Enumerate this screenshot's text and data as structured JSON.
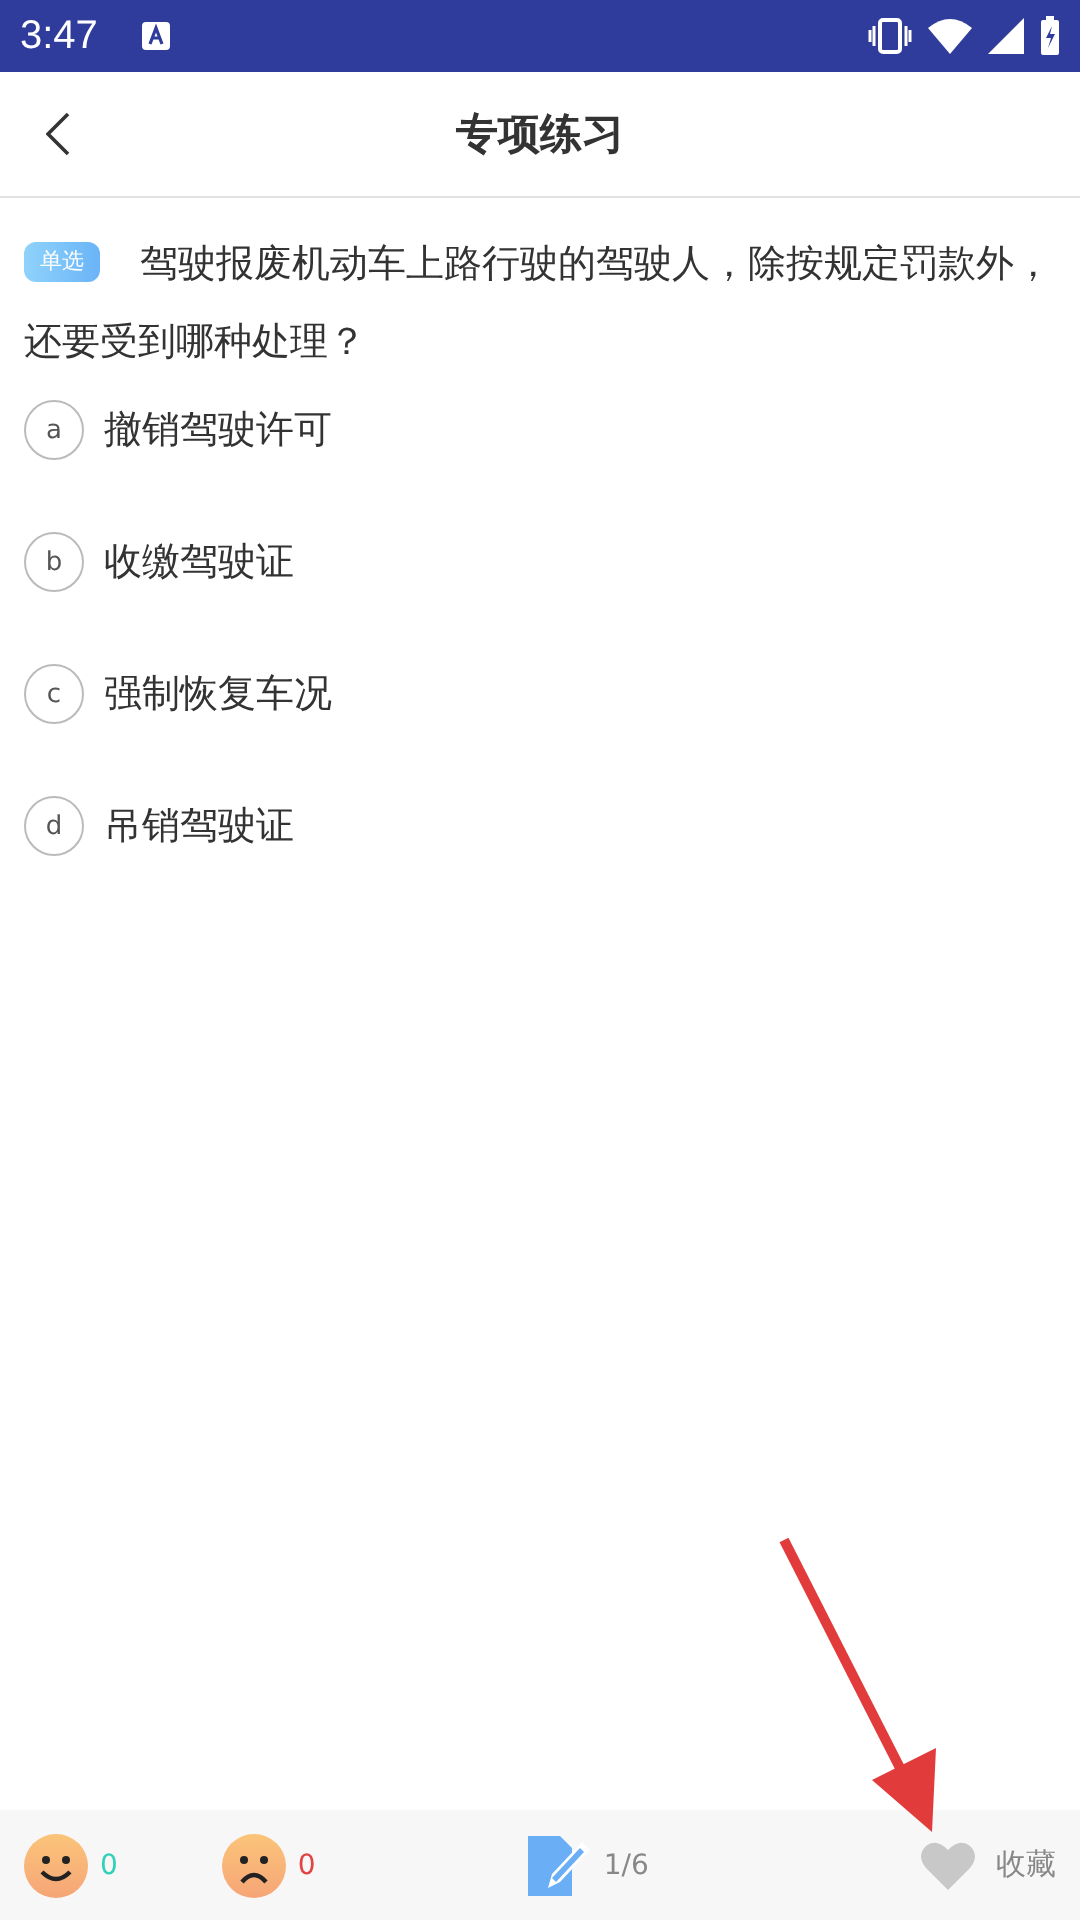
{
  "status_bar": {
    "time": "3:47"
  },
  "header": {
    "title": "专项练习"
  },
  "question": {
    "tag": "单选",
    "text": "驾驶报废机动车上路行驶的驾驶人，除按规定罚款外，还要受到哪种处理？"
  },
  "options": [
    {
      "letter": "a",
      "text": "撤销驾驶许可",
      "selected": false
    },
    {
      "letter": "b",
      "text": "收缴驾驶证",
      "selected": false
    },
    {
      "letter": "c",
      "text": "强制恢复车况",
      "selected": false
    },
    {
      "letter": "d",
      "text": "吊销驾驶证",
      "selected": false
    }
  ],
  "bottom_bar": {
    "correct_count": "0",
    "wrong_count": "0",
    "progress": "1/6",
    "favorite_label": "收藏",
    "favorited": false
  }
}
